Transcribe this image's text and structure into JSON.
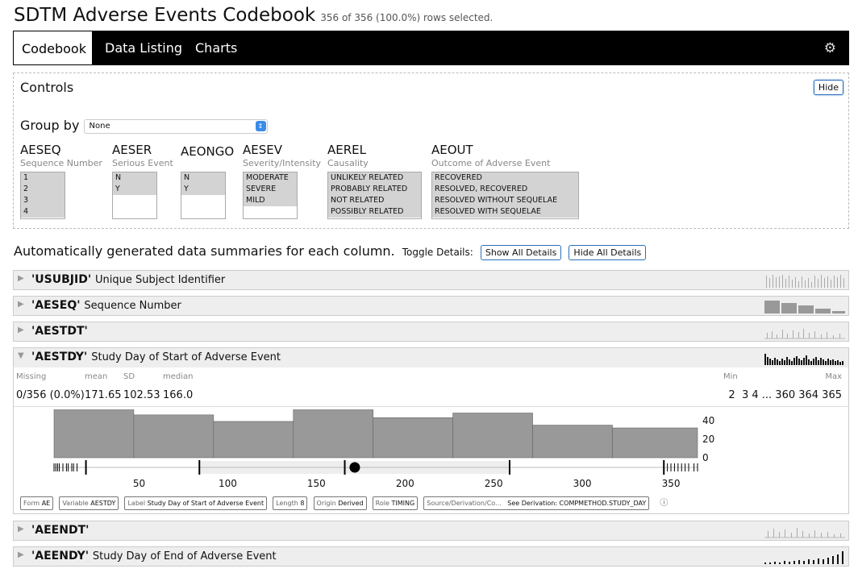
{
  "app": {
    "title": "SDTM Adverse Events Codebook",
    "status": "356 of 356 (100.0%) rows selected."
  },
  "nav": {
    "tabs": [
      "Codebook",
      "Data Listing",
      "Charts"
    ],
    "active": "Codebook",
    "gear_icon": "gear-icon"
  },
  "controls": {
    "title": "Controls",
    "hide_label": "Hide",
    "group_by_label": "Group by",
    "group_by_value": "None",
    "filters": [
      {
        "name": "AESEQ",
        "label": "Sequence Number",
        "options": [
          "1",
          "2",
          "3",
          "4"
        ]
      },
      {
        "name": "AESER",
        "label": "Serious Event",
        "options": [
          "N",
          "Y"
        ]
      },
      {
        "name": "AEONGO",
        "label": "",
        "options": [
          "N",
          "Y"
        ]
      },
      {
        "name": "AESEV",
        "label": "Severity/Intensity",
        "options": [
          "MODERATE",
          "SEVERE",
          "MILD"
        ]
      },
      {
        "name": "AEREL",
        "label": "Causality",
        "options": [
          "UNLIKELY RELATED",
          "PROBABLY RELATED",
          "NOT RELATED",
          "POSSIBLY RELATED"
        ]
      },
      {
        "name": "AEOUT",
        "label": "Outcome of Adverse Event",
        "options": [
          "RECOVERED",
          "RESOLVED, RECOVERED",
          "RESOLVED WITHOUT SEQUELAE",
          "RESOLVED WITH SEQUELAE"
        ]
      }
    ]
  },
  "summary": {
    "heading": "Automatically generated data summaries for each column.",
    "toggle_label": "Toggle Details:",
    "show_all": "Show All Details",
    "hide_all": "Hide All Details"
  },
  "variables": [
    {
      "name": "'USUBJID'",
      "label": "Unique Subject Identifier"
    },
    {
      "name": "'AESEQ'",
      "label": "Sequence Number"
    },
    {
      "name": "'AESTDT'",
      "label": ""
    },
    {
      "name": "'AESTDY'",
      "label": "Study Day of Start of Adverse Event"
    },
    {
      "name": "'AEENDT'",
      "label": ""
    },
    {
      "name": "'AEENDY'",
      "label": "Study Day of End of Adverse Event"
    }
  ],
  "aestdy_details": {
    "labels": {
      "missing": "Missing",
      "mean": "mean",
      "sd": "SD",
      "median": "median",
      "min": "Min",
      "max": "Max"
    },
    "missing": "0/356 (0.0%)",
    "mean": "171.65",
    "sd": "102.53",
    "median": "166.0",
    "extremes": "2  3 4 ... 360 364 365",
    "meta": [
      {
        "k": "Form",
        "v": "AE"
      },
      {
        "k": "Variable",
        "v": "AESTDY"
      },
      {
        "k": "Label",
        "v": "Study Day of Start of Adverse Event"
      },
      {
        "k": "Length",
        "v": "8"
      },
      {
        "k": "Origin",
        "v": "Derived"
      },
      {
        "k": "Role",
        "v": "TIMING"
      },
      {
        "k": "Source/Derivation/Co...",
        "v": "See Derivation: COMPMETHOD.STUDY_DAY"
      }
    ],
    "info_icon": "info-icon"
  },
  "chart_data": {
    "type": "bar",
    "title": "",
    "xlabel": "",
    "ylabel": "",
    "xlim": [
      0,
      380
    ],
    "ylim": [
      0,
      45
    ],
    "x_ticks": [
      50,
      100,
      150,
      200,
      250,
      300,
      350
    ],
    "y_ticks": [
      0,
      20,
      40
    ],
    "bins": [
      {
        "x0": 2,
        "x1": 47,
        "count": 52
      },
      {
        "x0": 47,
        "x1": 92,
        "count": 46
      },
      {
        "x0": 92,
        "x1": 137,
        "count": 39
      },
      {
        "x0": 137,
        "x1": 182,
        "count": 52
      },
      {
        "x0": 182,
        "x1": 227,
        "count": 43
      },
      {
        "x0": 227,
        "x1": 272,
        "count": 48
      },
      {
        "x0": 272,
        "x1": 317,
        "count": 35
      },
      {
        "x0": 317,
        "x1": 365,
        "count": 32
      }
    ],
    "boxplot": {
      "min": 2,
      "q1": 84,
      "median": 166,
      "mean": 171.65,
      "q3": 259,
      "max": 365
    }
  },
  "colors": {
    "nav_bg": "#000000",
    "bar": "#999999",
    "button_border": "#2a6ebb",
    "select_arrow": "#3b8ce8"
  }
}
